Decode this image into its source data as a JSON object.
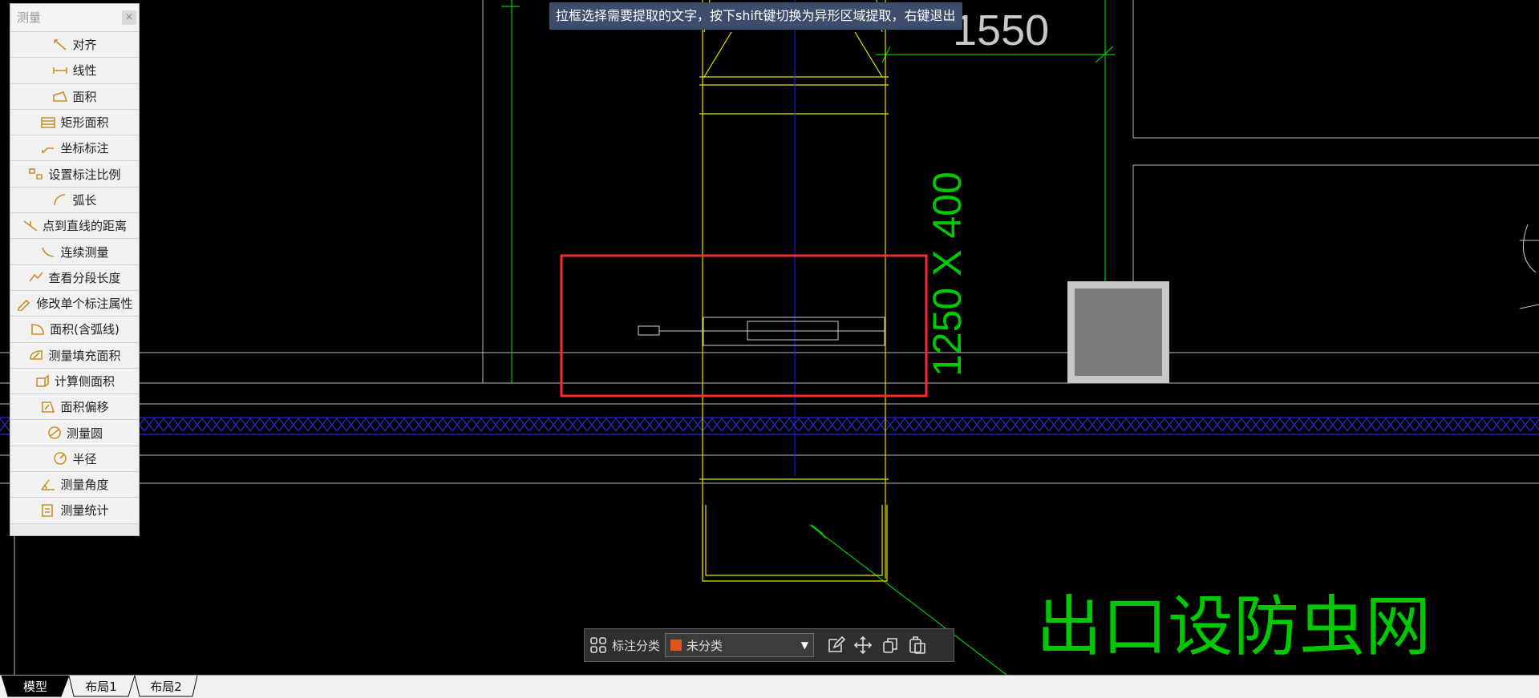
{
  "hint": "拉框选择需要提取的文字，按下shift键切换为异形区域提取，右键退出",
  "panel": {
    "title": "测量",
    "close": "×",
    "items": [
      {
        "label": "对齐",
        "icon": "align-measure-icon"
      },
      {
        "label": "线性",
        "icon": "linear-measure-icon"
      },
      {
        "label": "面积",
        "icon": "area-icon"
      },
      {
        "label": "矩形面积",
        "icon": "rect-area-icon"
      },
      {
        "label": "坐标标注",
        "icon": "coordinate-icon"
      },
      {
        "label": "设置标注比例",
        "icon": "scale-icon"
      },
      {
        "label": "弧长",
        "icon": "arc-length-icon"
      },
      {
        "label": "点到直线的距离",
        "icon": "point-line-icon"
      },
      {
        "label": "连续测量",
        "icon": "continuous-measure-icon"
      },
      {
        "label": "查看分段长度",
        "icon": "segment-length-icon"
      },
      {
        "label": "修改单个标注属性",
        "icon": "edit-dimension-icon"
      },
      {
        "label": "面积(含弧线)",
        "icon": "arc-area-icon"
      },
      {
        "label": "测量填充面积",
        "icon": "hatch-area-icon"
      },
      {
        "label": "计算侧面积",
        "icon": "side-area-icon"
      },
      {
        "label": "面积偏移",
        "icon": "area-offset-icon"
      },
      {
        "label": "测量圆",
        "icon": "circle-measure-icon"
      },
      {
        "label": "半径",
        "icon": "radius-icon"
      },
      {
        "label": "测量角度",
        "icon": "angle-icon"
      },
      {
        "label": "测量统计",
        "icon": "statistics-icon"
      }
    ]
  },
  "drawing": {
    "dim_top": "1550",
    "dim_vertical": "1250 X 400",
    "note": "出口设防虫网"
  },
  "toolbar": {
    "category_label": "标注分类",
    "category_value": "未分类",
    "category_color": "#e2541a"
  },
  "tabs": [
    "模型",
    "布局1",
    "布局2"
  ],
  "colors": {
    "background": "#000000",
    "yellow_line": "#e6e600",
    "green_line": "#00c800",
    "red_box": "#ff2a2a",
    "blue_axis": "#2222ff"
  }
}
